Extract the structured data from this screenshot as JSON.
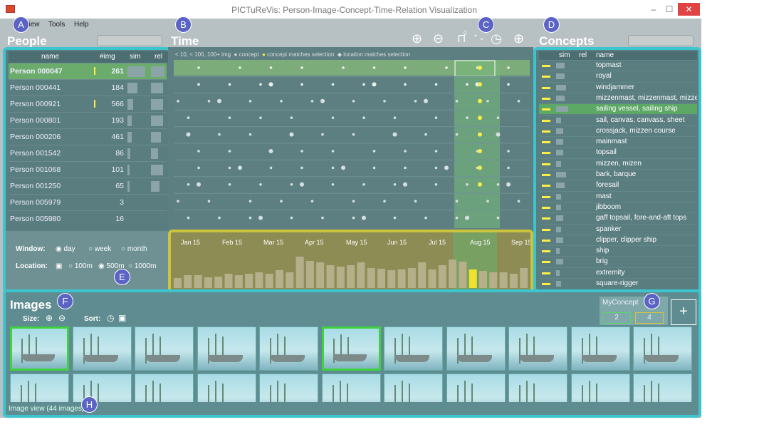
{
  "window": {
    "title": "PICTuReVis: Person-Image-Concept-Time-Relation Visualization",
    "minimize": "–",
    "maximize": "☐",
    "close": "✕"
  },
  "menu": {
    "view": "View",
    "tools": "Tools",
    "help": "Help"
  },
  "markers": [
    "A",
    "B",
    "C",
    "D",
    "E",
    "F",
    "G",
    "H"
  ],
  "people": {
    "header": "People",
    "columns": {
      "name": "name",
      "img": "#img",
      "sim": "sim",
      "rel": "rel"
    },
    "rows": [
      {
        "name": "Person 000047",
        "count": "261",
        "sim": 0.9,
        "rel": 0.8,
        "marked": true
      },
      {
        "name": "Person 000441",
        "count": "184",
        "sim": 0.5,
        "rel": 0.7,
        "marked": false
      },
      {
        "name": "Person 000921",
        "count": "566",
        "sim": 0.3,
        "rel": 0.7,
        "marked": true
      },
      {
        "name": "Person 000801",
        "count": "193",
        "sim": 0.2,
        "rel": 0.7,
        "marked": false
      },
      {
        "name": "Person 000206",
        "count": "461",
        "sim": 0.2,
        "rel": 0.6,
        "marked": false
      },
      {
        "name": "Person 001542",
        "count": "86",
        "sim": 0.15,
        "rel": 0.4,
        "marked": false
      },
      {
        "name": "Person 001068",
        "count": "101",
        "sim": 0.1,
        "rel": 0.7,
        "marked": false
      },
      {
        "name": "Person 001250",
        "count": "65",
        "sim": 0.1,
        "rel": 0.5,
        "marked": false
      },
      {
        "name": "Person 005979",
        "count": "3",
        "sim": 0,
        "rel": 0,
        "marked": false
      },
      {
        "name": "Person 005980",
        "count": "16",
        "sim": 0,
        "rel": 0,
        "marked": false
      }
    ],
    "window_label": "Window:",
    "window_options": [
      "day",
      "week",
      "month"
    ],
    "window_selected": "day",
    "location_label": "Location:",
    "location_options": [
      "100m",
      "500m",
      "1000m"
    ],
    "location_selected": "500m"
  },
  "time": {
    "header": "Time",
    "legend": [
      "< 10, < 100, 100+ img",
      "concept",
      "concept matches selection",
      "location matches selection"
    ],
    "months": [
      "Jan 15",
      "Feb 15",
      "Mar 15",
      "Apr 15",
      "May 15",
      "Jun 15",
      "Jul 15",
      "Aug 15",
      "Sep 15"
    ],
    "hist": [
      14,
      18,
      18,
      15,
      16,
      20,
      18,
      20,
      22,
      20,
      25,
      22,
      44,
      38,
      36,
      32,
      30,
      32,
      36,
      28,
      27,
      25,
      26,
      28,
      36,
      26,
      32,
      40,
      37,
      26,
      24,
      22,
      22,
      20,
      28
    ]
  },
  "toolbar": {
    "zoom_in": "zoom-in-icon",
    "zoom_out": "zoom-out-icon",
    "slider": "slider-icon",
    "clock": "clock-icon",
    "globe": "globe-icon",
    "slider_value": "0"
  },
  "concepts": {
    "header": "Concepts",
    "columns": {
      "sim": "sim",
      "rel": "rel",
      "name": "name"
    },
    "rows": [
      {
        "name": "topmast",
        "sim": 0.5
      },
      {
        "name": "royal",
        "sim": 0.5
      },
      {
        "name": "windjammer",
        "sim": 0.6
      },
      {
        "name": "mizzenmast, mizzenmast, mizze",
        "sim": 0.5
      },
      {
        "name": "sailing vessel, sailing ship",
        "sim": 0.7,
        "selected": true
      },
      {
        "name": "sail, canvas, canvass, sheet",
        "sim": 0.3
      },
      {
        "name": "crossjack, mizzen course",
        "sim": 0.4
      },
      {
        "name": "mainmast",
        "sim": 0.4
      },
      {
        "name": "topsail",
        "sim": 0.4
      },
      {
        "name": "mizzen, mizen",
        "sim": 0.3
      },
      {
        "name": "bark, barque",
        "sim": 0.6
      },
      {
        "name": "foresail",
        "sim": 0.5
      },
      {
        "name": "mast",
        "sim": 0.3
      },
      {
        "name": "jibboom",
        "sim": 0.3
      },
      {
        "name": "gaff topsail, fore-and-aft tops",
        "sim": 0.4
      },
      {
        "name": "spanker",
        "sim": 0.3
      },
      {
        "name": "clipper, clipper ship",
        "sim": 0.4
      },
      {
        "name": "ship",
        "sim": 0.2
      },
      {
        "name": "brig",
        "sim": 0.4
      },
      {
        "name": "extremity",
        "sim": 0.2
      },
      {
        "name": "square-rigger",
        "sim": 0.3
      }
    ]
  },
  "images": {
    "header": "Images",
    "size_label": "Size:",
    "sort_label": "Sort:",
    "footer": "Image view (44 images)",
    "myconcept": {
      "label": "MyConcept",
      "a": "2",
      "b": "4"
    },
    "add": "+"
  }
}
